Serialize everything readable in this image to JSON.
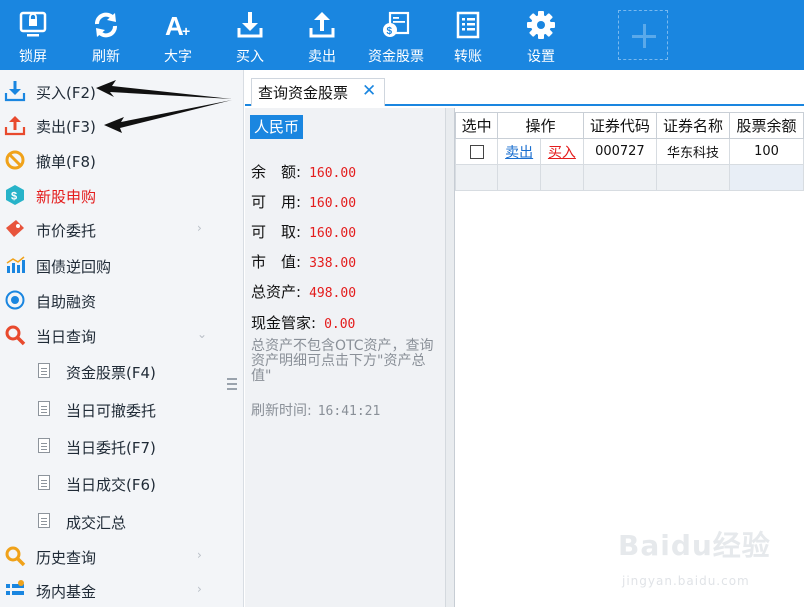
{
  "toolbar": {
    "buttons": [
      {
        "label": "锁屏",
        "icon": "lock-screen-icon"
      },
      {
        "label": "刷新",
        "icon": "refresh-icon"
      },
      {
        "label": "大字",
        "icon": "font-size-icon"
      },
      {
        "label": "买入",
        "icon": "download-icon"
      },
      {
        "label": "卖出",
        "icon": "upload-icon"
      },
      {
        "label": "资金股票",
        "icon": "funds-icon"
      },
      {
        "label": "转账",
        "icon": "transfer-icon"
      },
      {
        "label": "设置",
        "icon": "gear-icon"
      }
    ],
    "accent_color": "#1a86e0"
  },
  "sidebar": {
    "items": [
      {
        "label": "买入(F2)",
        "icon": "download-icon"
      },
      {
        "label": "卖出(F3)",
        "icon": "upload-icon"
      },
      {
        "label": "撤单(F8)",
        "icon": "cancel-icon"
      },
      {
        "label": "新股申购",
        "icon": "coin-icon",
        "highlight": true
      },
      {
        "label": "市价委托",
        "icon": "ticket-icon"
      },
      {
        "label": "国债逆回购",
        "icon": "bar-chart-icon"
      },
      {
        "label": "自助融资",
        "icon": "finance-icon"
      },
      {
        "label": "当日查询",
        "icon": "search-icon",
        "expanded": true
      },
      {
        "label": "历史查询",
        "icon": "search-icon"
      },
      {
        "label": "场内基金",
        "icon": "fund-icon"
      }
    ],
    "sub_items": [
      {
        "label": "资金股票(F4)"
      },
      {
        "label": "当日可撤委托"
      },
      {
        "label": "当日委托(F7)"
      },
      {
        "label": "当日成交(F6)"
      },
      {
        "label": "成交汇总"
      }
    ]
  },
  "tabs": [
    {
      "label": "查询资金股票",
      "close": "✕"
    }
  ],
  "assets": {
    "currency": "人民币",
    "rows": [
      {
        "label": "余　额:",
        "value": "160.00"
      },
      {
        "label": "可　用:",
        "value": "160.00"
      },
      {
        "label": "可　取:",
        "value": "160.00"
      },
      {
        "label": "市　值:",
        "value": "338.00"
      },
      {
        "label": "总资产:",
        "value": "498.00"
      },
      {
        "label": "现金管家:",
        "value": "0.00"
      }
    ],
    "note": "总资产不包含OTC资产，查询资产明细可点击下方\"资产总值\"",
    "refresh_label": "刷新时间:",
    "refresh_time": "16:41:21"
  },
  "grid": {
    "columns": [
      "选中",
      "操作",
      "证券代码",
      "证券名称",
      "股票余额"
    ],
    "rows": [
      {
        "sell": "卖出",
        "buy": "买入",
        "code": "000727",
        "name": "华东科技",
        "balance": "100"
      }
    ]
  },
  "watermark": {
    "logo": "Baidu经验",
    "url": "jingyan.baidu.com"
  }
}
